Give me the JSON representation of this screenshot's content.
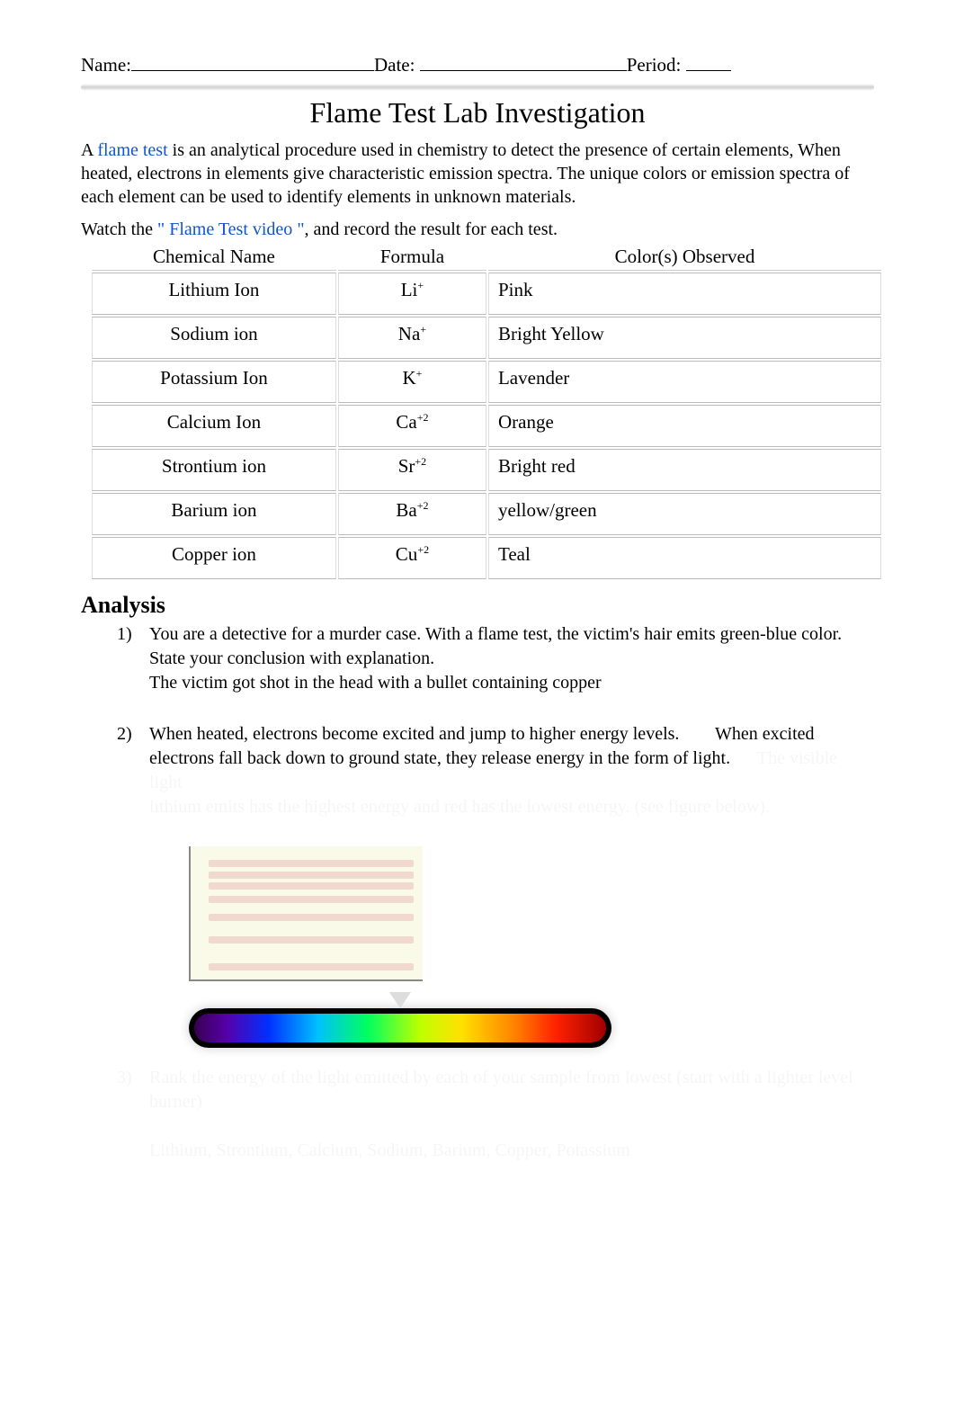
{
  "header": {
    "name_label": "Name:",
    "date_label": "Date:",
    "period_label": "Period:"
  },
  "title": "Flame Test Lab Investigation",
  "intro": {
    "prefix": "A ",
    "flame_test": "flame test",
    "rest": " is an analytical procedure used in chemistry to detect the presence of certain elements, When heated, electrons in elements give characteristic emission spectra. The unique colors or emission spectra of each element can be used to identify elements in unknown materials."
  },
  "watch": {
    "pre": "Watch the ",
    "q1": "\"",
    "link": " Flame Test video",
    "q2": " \"",
    "post": ", and record the result for each test."
  },
  "table": {
    "headers": {
      "c1": "Chemical Name",
      "c2": "Formula",
      "c3": "Color(s) Observed"
    },
    "rows": [
      {
        "name": "Lithium Ion",
        "base": "Li",
        "charge": "+",
        "color": "Pink"
      },
      {
        "name": "Sodium ion",
        "base": "Na",
        "charge": "+",
        "color": "Bright Yellow"
      },
      {
        "name": "Potassium Ion",
        "base": "K",
        "charge": "+",
        "color": "Lavender"
      },
      {
        "name": "Calcium  Ion",
        "base": "Ca",
        "charge": "+2",
        "color": "Orange"
      },
      {
        "name": "Strontium ion",
        "base": "Sr",
        "charge": "+2",
        "color": "Bright red"
      },
      {
        "name": "Barium ion",
        "base": "Ba",
        "charge": "+2",
        "color": "yellow/green"
      },
      {
        "name": "Copper ion",
        "base": "Cu",
        "charge": "+2",
        "color": "Teal"
      }
    ]
  },
  "analysis": {
    "heading": "Analysis",
    "q1": {
      "num": "1)",
      "prompt": "You are a detective for a murder case. With a flame test, the victim's hair emits green-blue color. State your conclusion with explanation.",
      "answer": "The victim got shot in the head with a bullet containing copper"
    },
    "q2": {
      "num": "2)",
      "part1": "When heated, electrons become excited and jump to higher energy levels. ",
      "part2": "When excited electrons fall back down to ground state, they release energy in the form of light.",
      "faded_a": "The visible light",
      "faded_b": "lithium emits has the highest energy and red has the lowest energy. (see figure below).",
      "q3num": "3)",
      "q3text": "Rank the energy of the light emitted by each of your sample from lowest (start with a lighter level burner)",
      "q3ans": "Lithium, Strontium, Calcium, Sodium, Barium, Copper, Potassium"
    }
  }
}
